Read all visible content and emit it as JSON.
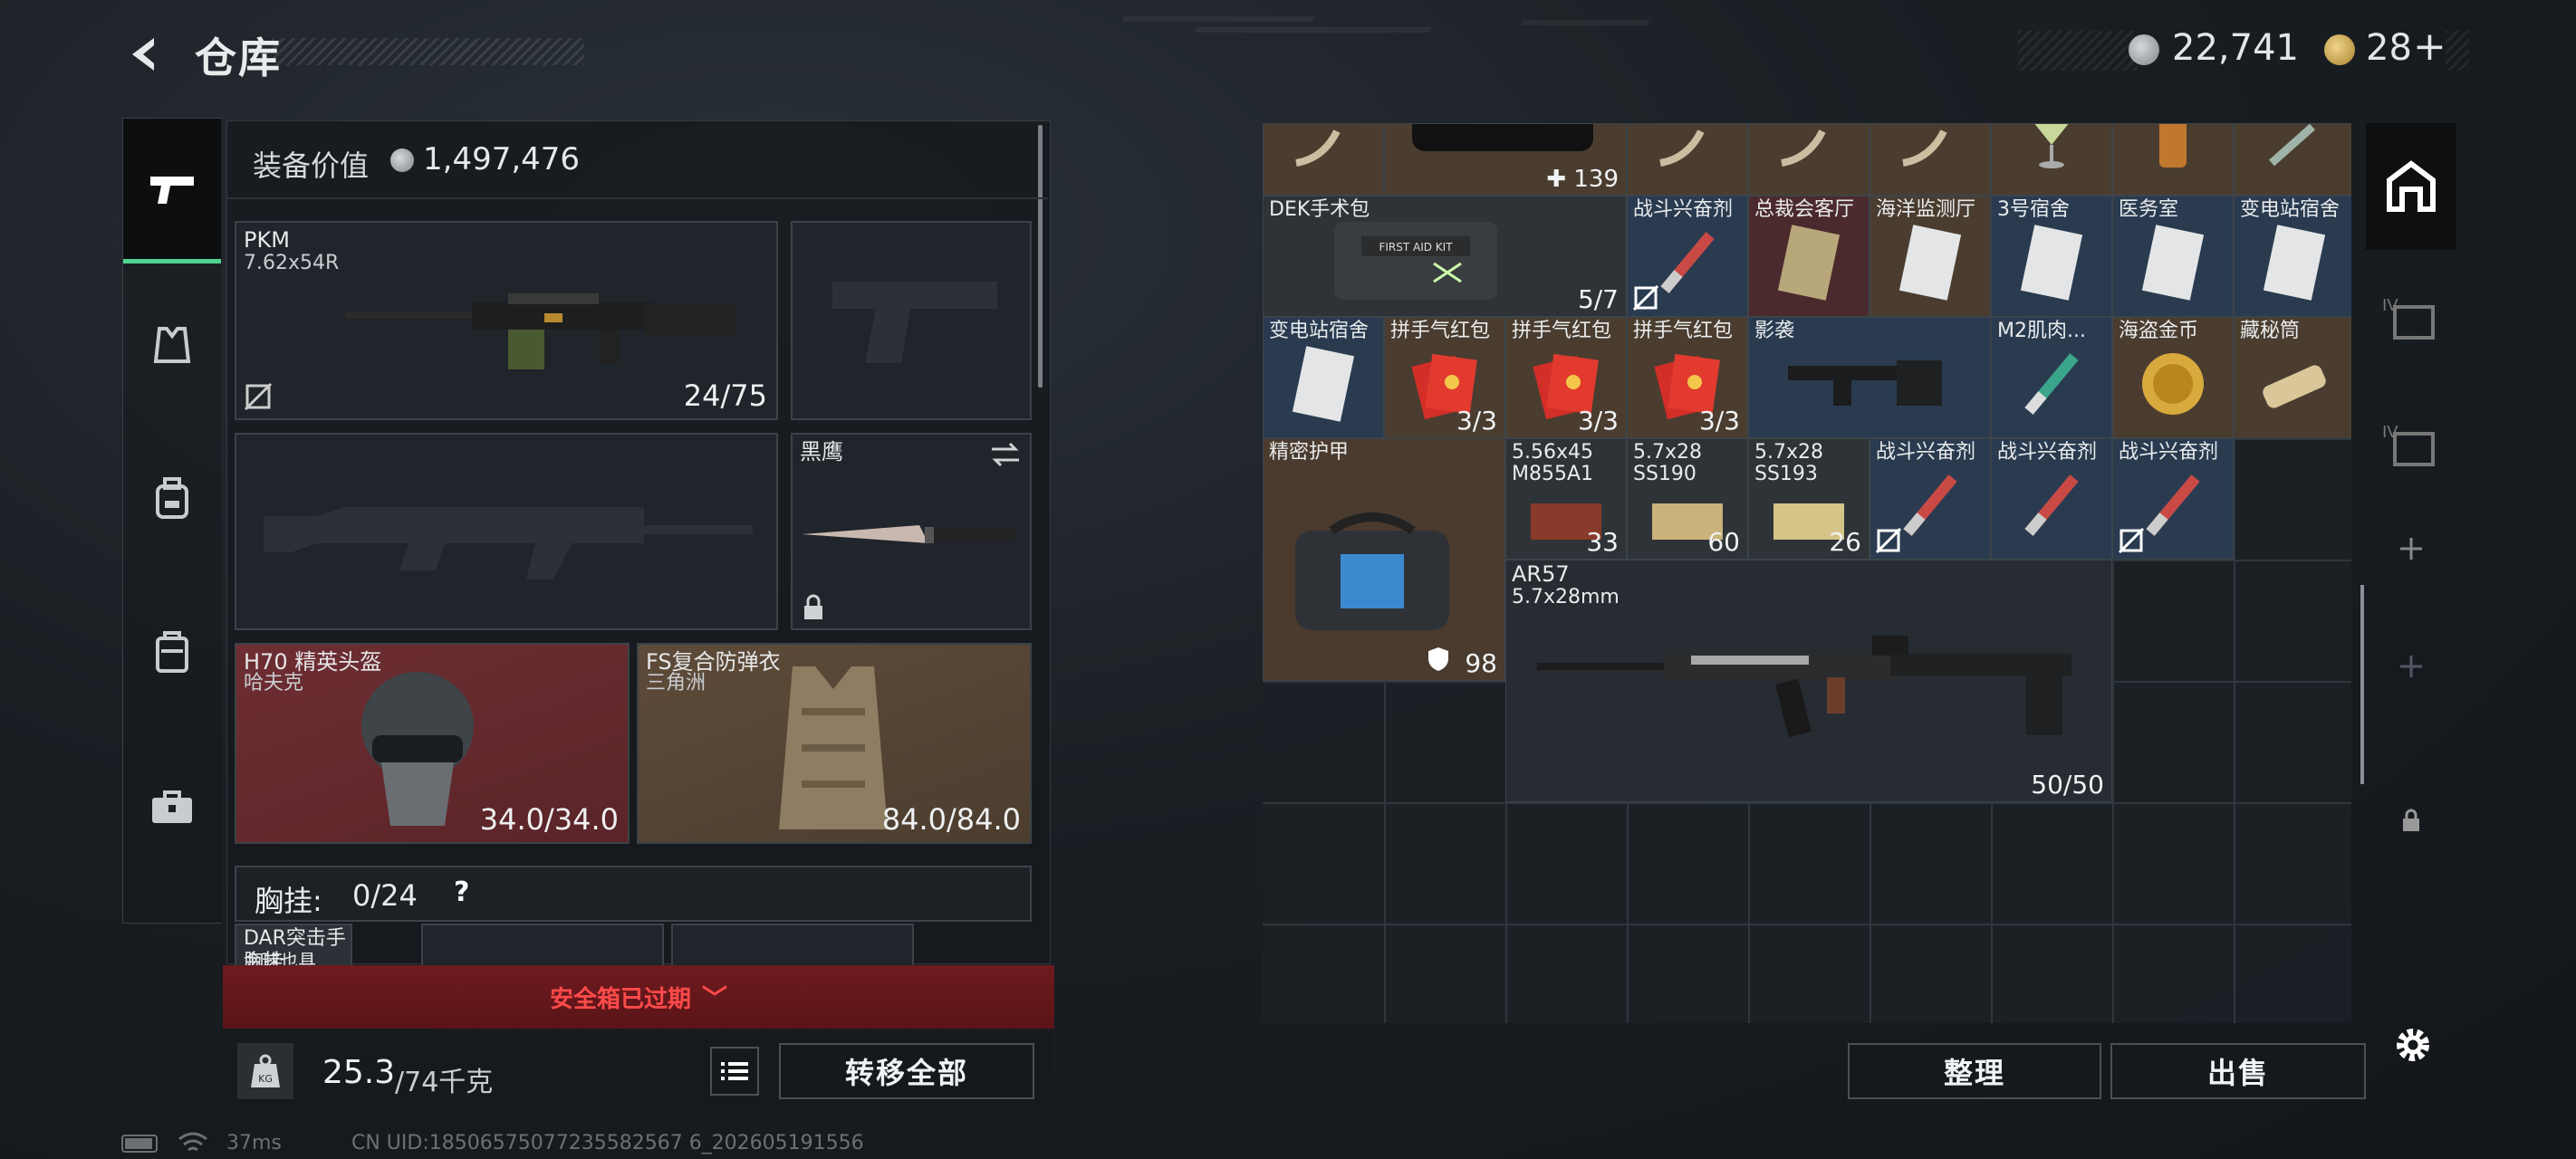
{
  "header": {
    "title": "仓库",
    "currency_silver": "22,741",
    "currency_gold": "28",
    "add_symbol": "+"
  },
  "side_tabs": [
    {
      "icon": "pistol-icon"
    },
    {
      "icon": "vest-icon"
    },
    {
      "icon": "backpack-icon"
    },
    {
      "icon": "case-icon"
    },
    {
      "icon": "toolbox-icon"
    }
  ],
  "loadout": {
    "value_label": "装备价值",
    "value": "1,497,476",
    "primary": {
      "name": "PKM",
      "caliber": "7.62x54R",
      "ammo": "24/75"
    },
    "melee": {
      "name": "黑鹰"
    },
    "helmet": {
      "name": "H70 精英头盔",
      "brand": "哈夫克",
      "durability": "34.0/34.0"
    },
    "armor": {
      "name": "FS复合防弹衣",
      "brand": "三角洲",
      "durability": "84.0/84.0"
    },
    "chest_rig": {
      "label": "胸挂:",
      "value": "0/24",
      "help": "?"
    },
    "chest_item": {
      "name": "DAR突击手胸挂",
      "sub": "金球也具"
    }
  },
  "safebox": {
    "text": "安全箱已过期",
    "chevron": "﹀"
  },
  "weight": {
    "current": "25.3",
    "capacity": "/74千克",
    "icon_text": "KG"
  },
  "buttons": {
    "transfer_all": "转移全部",
    "organize": "整理",
    "sell": "出售"
  },
  "grid_top_count": "139",
  "grid_items": [
    {
      "name": "DEK手术包",
      "count": "5/7",
      "color": "gray"
    },
    {
      "name": "战斗兴奋剂",
      "color": "blue"
    },
    {
      "name": "总裁会客厅",
      "color": "red"
    },
    {
      "name": "海洋监测厅",
      "color": "gold"
    },
    {
      "name": "3号宿舍",
      "color": "blue"
    },
    {
      "name": "医务室",
      "color": "blue"
    },
    {
      "name": "变电站宿舍",
      "color": "blue"
    },
    {
      "name": "变电站宿舍",
      "color": "blue"
    },
    {
      "name": "拼手气红包",
      "count": "3/3",
      "color": "gold"
    },
    {
      "name": "拼手气红包",
      "count": "3/3",
      "color": "gold"
    },
    {
      "name": "拼手气红包",
      "count": "3/3",
      "color": "gold"
    },
    {
      "name": "影袭",
      "color": "blue"
    },
    {
      "name": "M2肌肉...",
      "color": "blue"
    },
    {
      "name": "海盗金币",
      "color": "gold"
    },
    {
      "name": "藏秘筒",
      "color": "gold"
    },
    {
      "name": "精密护甲",
      "count": "98",
      "color": "gold"
    },
    {
      "name": "5.56x45",
      "sub": "M855A1",
      "count": "33",
      "color": "gray"
    },
    {
      "name": "5.7x28",
      "sub": "SS190",
      "count": "60",
      "color": "gray"
    },
    {
      "name": "5.7x28",
      "sub": "SS193",
      "count": "26",
      "color": "gray"
    },
    {
      "name": "战斗兴奋剂",
      "color": "blue"
    },
    {
      "name": "战斗兴奋剂",
      "color": "blue"
    },
    {
      "name": "战斗兴奋剂",
      "color": "blue"
    },
    {
      "name": "AR57",
      "sub": "5.7x28mm",
      "count": "50/50",
      "color": "plain"
    }
  ],
  "status": {
    "ping": "37ms",
    "uid": "CN UID:18506575077235582567 6_202605191556"
  },
  "colors": {
    "accent_green": "#4fd191",
    "rarity_gold": "#4a3d30",
    "rarity_red": "#4b2a2d",
    "rarity_blue": "#2a3b50",
    "alert_red": "#ff4a4a"
  }
}
